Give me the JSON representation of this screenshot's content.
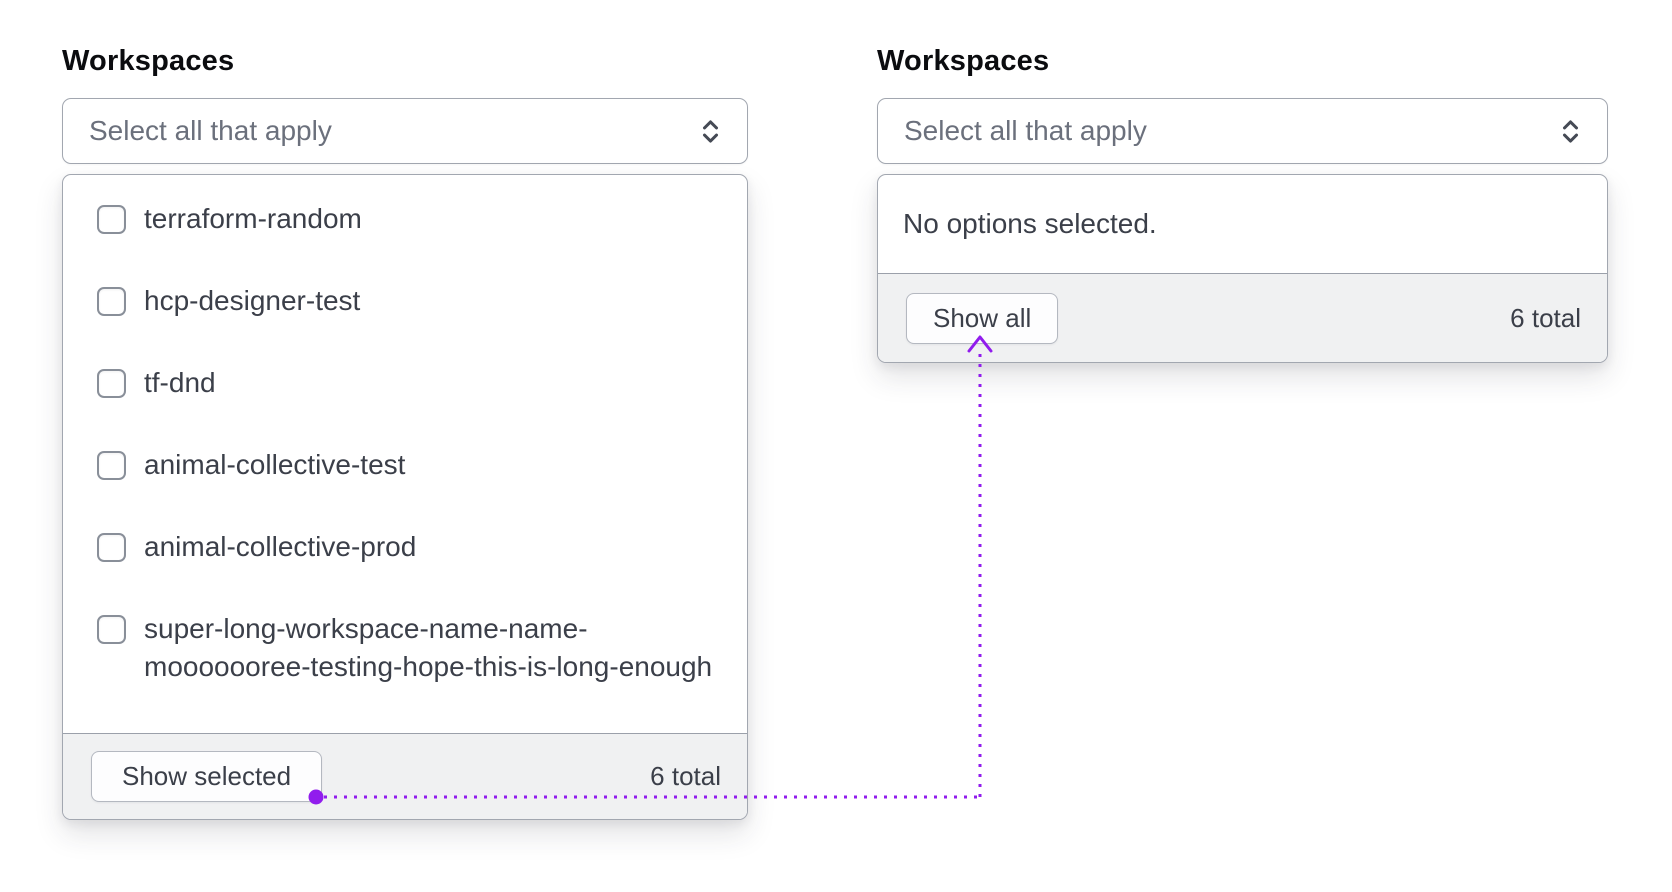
{
  "accent": {
    "annotation_purple": "#911ced"
  },
  "left_select": {
    "label": "Workspaces",
    "placeholder": "Select all that apply",
    "options": [
      "terraform-random",
      "hcp-designer-test",
      "tf-dnd",
      "animal-collective-test",
      "animal-collective-prod",
      "super-long-workspace-name-name-mooooooree-testing-hope-this-is-long-enough"
    ],
    "footer": {
      "button": "Show selected",
      "total": "6 total"
    }
  },
  "right_select": {
    "label": "Workspaces",
    "placeholder": "Select all that apply",
    "empty_message": "No options selected.",
    "footer": {
      "button": "Show all",
      "total": "6 total"
    }
  }
}
